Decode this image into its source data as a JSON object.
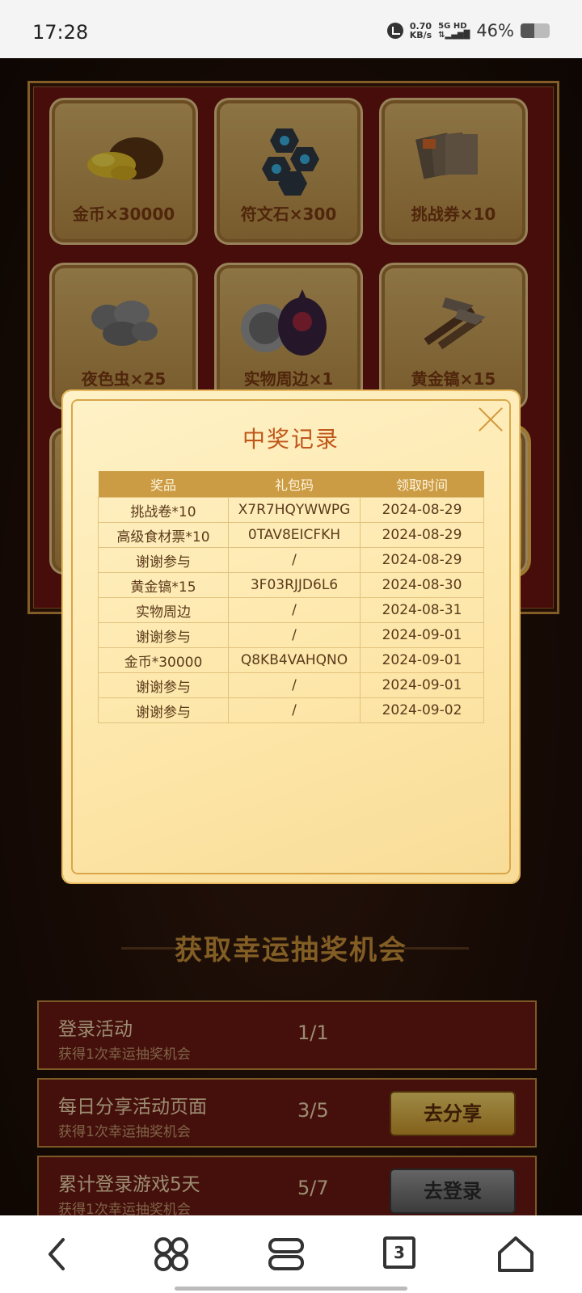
{
  "status_bar": {
    "time": "17:28",
    "speed_value": "0.70",
    "speed_unit": "KB/s",
    "network_top": "5G HD",
    "battery": "46%",
    "battery_level": 0.46
  },
  "prize_board": {
    "tiles": [
      {
        "label": "金币×30000",
        "icon": "gold-coins-icon"
      },
      {
        "label": "符文石×300",
        "icon": "rune-stone-icon"
      },
      {
        "label": "挑战券×10",
        "icon": "challenge-ticket-icon"
      },
      {
        "label": "夜色虫×25",
        "icon": "night-bug-icon"
      },
      {
        "label": "实物周边×1",
        "icon": "merch-icon"
      },
      {
        "label": "黄金镐×15",
        "icon": "golden-pickaxe-icon"
      }
    ]
  },
  "modal": {
    "title": "中奖记录",
    "columns": [
      "奖品",
      "礼包码",
      "领取时间"
    ],
    "rows": [
      [
        "挑战卷*10",
        "X7R7HQYWWPG",
        "2024-08-29"
      ],
      [
        "高级食材票*10",
        "0TAV8EICFKH",
        "2024-08-29"
      ],
      [
        "谢谢参与",
        "/",
        "2024-08-29"
      ],
      [
        "黄金镐*15",
        "3F03RJJD6L6",
        "2024-08-30"
      ],
      [
        "实物周边",
        "/",
        "2024-08-31"
      ],
      [
        "谢谢参与",
        "/",
        "2024-09-01"
      ],
      [
        "金币*30000",
        "Q8KB4VAHQNO",
        "2024-09-01"
      ],
      [
        "谢谢参与",
        "/",
        "2024-09-01"
      ],
      [
        "谢谢参与",
        "/",
        "2024-09-02"
      ]
    ]
  },
  "section_title": "获取幸运抽奖机会",
  "tasks": [
    {
      "title": "登录活动",
      "subtitle": "获得1次幸运抽奖机会",
      "count": "1/1",
      "button": ""
    },
    {
      "title": "每日分享活动页面",
      "subtitle": "获得1次幸运抽奖机会",
      "count": "3/5",
      "button": "去分享"
    },
    {
      "title": "累计登录游戏5天",
      "subtitle": "获得1次幸运抽奖机会",
      "count": "5/7",
      "button": "去登录"
    }
  ],
  "nav": {
    "tab_count": "3",
    "icons": [
      "back-icon",
      "apps-icon",
      "tabs-menu-icon",
      "tab-count-icon",
      "home-icon"
    ]
  }
}
